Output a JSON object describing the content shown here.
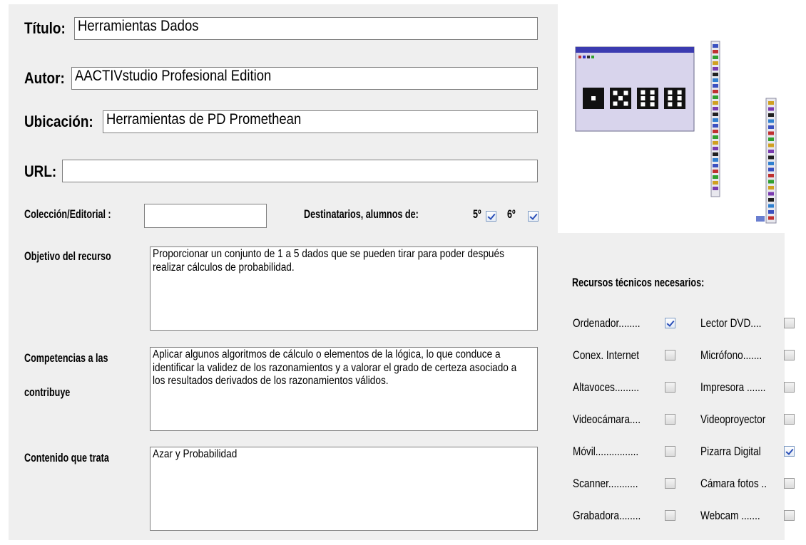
{
  "form": {
    "titulo": {
      "label": "Título:",
      "value": "Herramientas Dados"
    },
    "autor": {
      "label": "Autor:",
      "value": "AACTIVstudio Profesional Edition"
    },
    "ubicacion": {
      "label": "Ubicación:",
      "value": "Herramientas de PD Promethean"
    },
    "url": {
      "label": "URL:",
      "value": ""
    },
    "coleccion": {
      "label": "Colección/Editorial :",
      "value": ""
    },
    "destinatarios": {
      "label": "Destinatarios, alumnos de:",
      "grades": [
        {
          "label": "5º",
          "checked": true
        },
        {
          "label": "6º",
          "checked": true
        }
      ]
    },
    "objetivo": {
      "label": "Objetivo del recurso",
      "value": "Proporcionar un conjunto de 1 a 5 dados que se pueden tirar para poder después realizar cálculos de probabilidad."
    },
    "competencias": {
      "label_line1": "Competencias a las",
      "label_line2": "contribuye",
      "value": "Aplicar algunos algoritmos de cálculo o elementos de la lógica, lo que conduce a identificar la validez de los razonamientos y a valorar el grado de certeza asociado a los resultados derivados de los razonamientos válidos."
    },
    "contenido": {
      "label": "Contenido que trata",
      "value": "Azar y Probabilidad"
    }
  },
  "recursos": {
    "title": "Recursos técnicos necesarios:",
    "left": [
      {
        "label": "Ordenador........",
        "checked": true
      },
      {
        "label": "Conex. Internet",
        "checked": false
      },
      {
        "label": "Altavoces.........",
        "checked": false
      },
      {
        "label": "Videocámara....",
        "checked": false
      },
      {
        "label": "Móvil................",
        "checked": false
      },
      {
        "label": "Scanner...........",
        "checked": false
      },
      {
        "label": "Grabadora........",
        "checked": false
      }
    ],
    "right": [
      {
        "label": "Lector DVD....",
        "checked": false
      },
      {
        "label": "Micrófono.......",
        "checked": false
      },
      {
        "label": "Impresora .......",
        "checked": false
      },
      {
        "label": "Videoproyector",
        "checked": false
      },
      {
        "label": "Pizarra Digital",
        "checked": true
      },
      {
        "label": "Cámara fotos ..",
        "checked": false
      },
      {
        "label": "Webcam .......",
        "checked": false
      }
    ]
  },
  "screenshot": {
    "dice_count": 4
  }
}
